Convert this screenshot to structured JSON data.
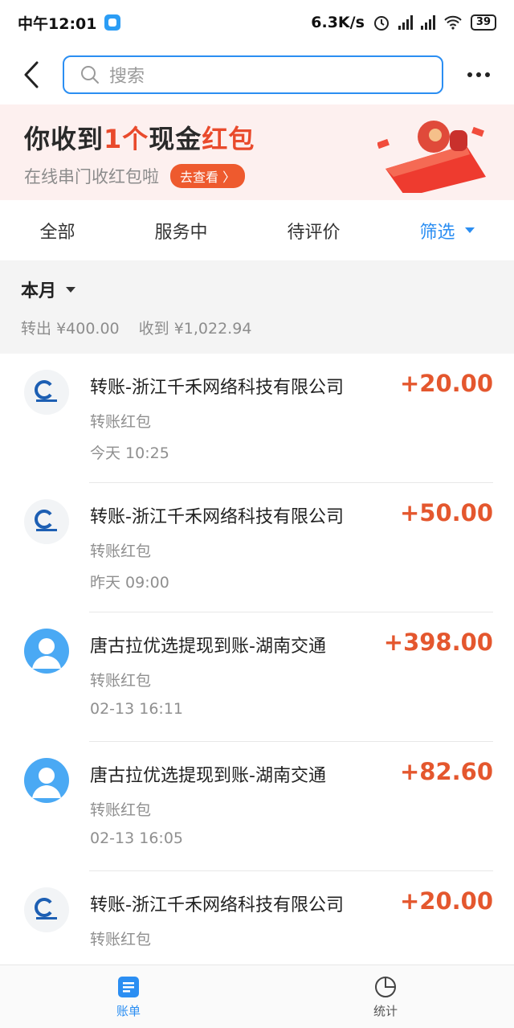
{
  "status": {
    "time": "中午12:01",
    "speed": "6.3K/s",
    "battery": "39"
  },
  "search": {
    "placeholder": "搜索"
  },
  "banner": {
    "title_a": "你收到",
    "title_count": "1个",
    "title_b": "现金",
    "title_c": "红包",
    "subtitle": "在线串门收红包啦",
    "button": "去查看 〉"
  },
  "tabs": {
    "all": "全部",
    "serving": "服务中",
    "to_review": "待评价",
    "filter": "筛选"
  },
  "month": {
    "label": "本月",
    "out_label": "转出",
    "out_value": "¥400.00",
    "in_label": "收到",
    "in_value": "¥1,022.94"
  },
  "items": [
    {
      "avatar": "qianhe-logo",
      "name": "转账-浙江千禾网络科技有限公司",
      "amount": "+20.00",
      "type": "转账红包",
      "time": "今天  10:25"
    },
    {
      "avatar": "qianhe-logo",
      "name": "转账-浙江千禾网络科技有限公司",
      "amount": "+50.00",
      "type": "转账红包",
      "time": "昨天  09:00"
    },
    {
      "avatar": "person",
      "name": "唐古拉优选提现到账-湖南交通",
      "amount": "+398.00",
      "type": "转账红包",
      "time": "02-13  16:11"
    },
    {
      "avatar": "person",
      "name": "唐古拉优选提现到账-湖南交通",
      "amount": "+82.60",
      "type": "转账红包",
      "time": "02-13  16:05"
    },
    {
      "avatar": "qianhe-logo",
      "name": "转账-浙江千禾网络科技有限公司",
      "amount": "+20.00",
      "type": "转账红包",
      "time": ""
    }
  ],
  "bottom_nav": {
    "bill": "账单",
    "stats": "统计"
  },
  "colors": {
    "accent": "#2b8ef2",
    "amount": "#e4572e",
    "banner_bg": "#fdf0ef"
  }
}
